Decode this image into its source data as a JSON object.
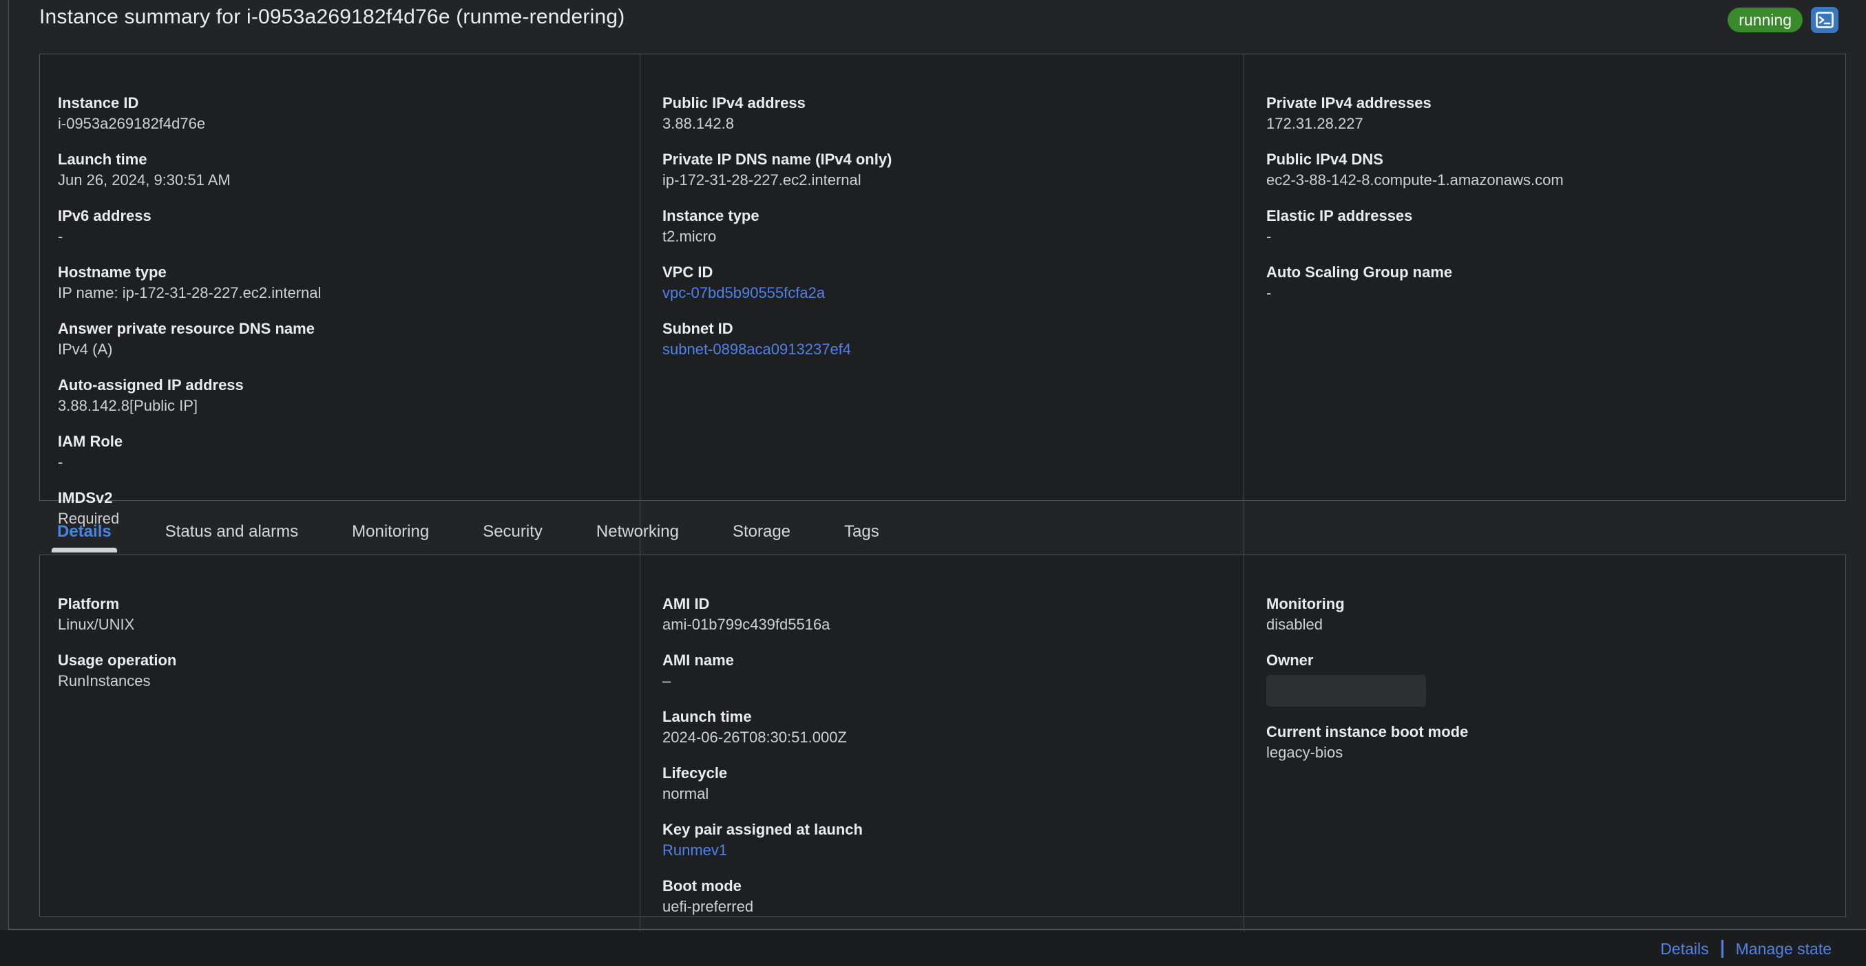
{
  "header": {
    "title": "Instance summary for i-0953a269182f4d76e (runme-rendering)",
    "status_badge": "running",
    "terminal_icon": "terminal-icon"
  },
  "colors": {
    "badge_green": "#398a2b",
    "link_blue": "#4f82e8",
    "active_tab_blue": "#4386e8",
    "terminal_button_blue": "#3a76c0"
  },
  "summary": {
    "columns": [
      {
        "fields": [
          {
            "label": "Instance ID",
            "value": "i-0953a269182f4d76e",
            "kind": "text"
          },
          {
            "label": "Launch time",
            "value": "Jun 26, 2024, 9:30:51 AM",
            "kind": "text"
          },
          {
            "label": "IPv6 address",
            "value": "-",
            "kind": "text"
          },
          {
            "label": "Hostname type",
            "value": "IP name: ip-172-31-28-227.ec2.internal",
            "kind": "text"
          },
          {
            "label": "Answer private resource DNS name",
            "value": "IPv4 (A)",
            "kind": "text"
          },
          {
            "label": "Auto-assigned IP address",
            "value": "3.88.142.8[Public IP]",
            "kind": "text"
          },
          {
            "label": "IAM Role",
            "value": "-",
            "kind": "text"
          },
          {
            "label": "IMDSv2",
            "value": "Required",
            "kind": "text"
          }
        ]
      },
      {
        "fields": [
          {
            "label": "Public IPv4 address",
            "value": "3.88.142.8",
            "kind": "text"
          },
          {
            "label": "Private IP DNS name (IPv4 only)",
            "value": "ip-172-31-28-227.ec2.internal",
            "kind": "text"
          },
          {
            "label": "Instance type",
            "value": "t2.micro",
            "kind": "text"
          },
          {
            "label": "VPC ID",
            "value": "vpc-07bd5b90555fcfa2a",
            "kind": "link"
          },
          {
            "label": "Subnet ID",
            "value": "subnet-0898aca0913237ef4",
            "kind": "link"
          }
        ]
      },
      {
        "fields": [
          {
            "label": "Private IPv4 addresses",
            "value": "172.31.28.227",
            "kind": "text"
          },
          {
            "label": "Public IPv4 DNS",
            "value": "ec2-3-88-142-8.compute-1.amazonaws.com",
            "kind": "text"
          },
          {
            "label": "Elastic IP addresses",
            "value": "-",
            "kind": "text"
          },
          {
            "label": "Auto Scaling Group name",
            "value": "-",
            "kind": "text"
          }
        ]
      }
    ]
  },
  "tabs": {
    "items": [
      {
        "label": "Details",
        "active": true
      },
      {
        "label": "Status and alarms",
        "active": false
      },
      {
        "label": "Monitoring",
        "active": false
      },
      {
        "label": "Security",
        "active": false
      },
      {
        "label": "Networking",
        "active": false
      },
      {
        "label": "Storage",
        "active": false
      },
      {
        "label": "Tags",
        "active": false
      }
    ]
  },
  "details": {
    "columns": [
      {
        "fields": [
          {
            "label": "Platform",
            "value": "Linux/UNIX",
            "kind": "text"
          },
          {
            "label": "Usage operation",
            "value": "RunInstances",
            "kind": "text"
          }
        ]
      },
      {
        "fields": [
          {
            "label": "AMI ID",
            "value": "ami-01b799c439fd5516a",
            "kind": "text"
          },
          {
            "label": "AMI name",
            "value": "–",
            "kind": "text"
          },
          {
            "label": "Launch time",
            "value": "2024-06-26T08:30:51.000Z",
            "kind": "text"
          },
          {
            "label": "Lifecycle",
            "value": "normal",
            "kind": "text"
          },
          {
            "label": "Key pair assigned at launch",
            "value": "Runmev1",
            "kind": "link"
          },
          {
            "label": "Boot mode",
            "value": "uefi-preferred",
            "kind": "text"
          }
        ]
      },
      {
        "fields": [
          {
            "label": "Monitoring",
            "value": "disabled",
            "kind": "text"
          },
          {
            "label": "Owner",
            "value": "",
            "kind": "redacted"
          },
          {
            "label": "Current instance boot mode",
            "value": "legacy-bios",
            "kind": "text"
          }
        ]
      }
    ]
  },
  "footer": {
    "links": [
      {
        "label": "Details"
      },
      {
        "label": "Manage state"
      }
    ]
  }
}
